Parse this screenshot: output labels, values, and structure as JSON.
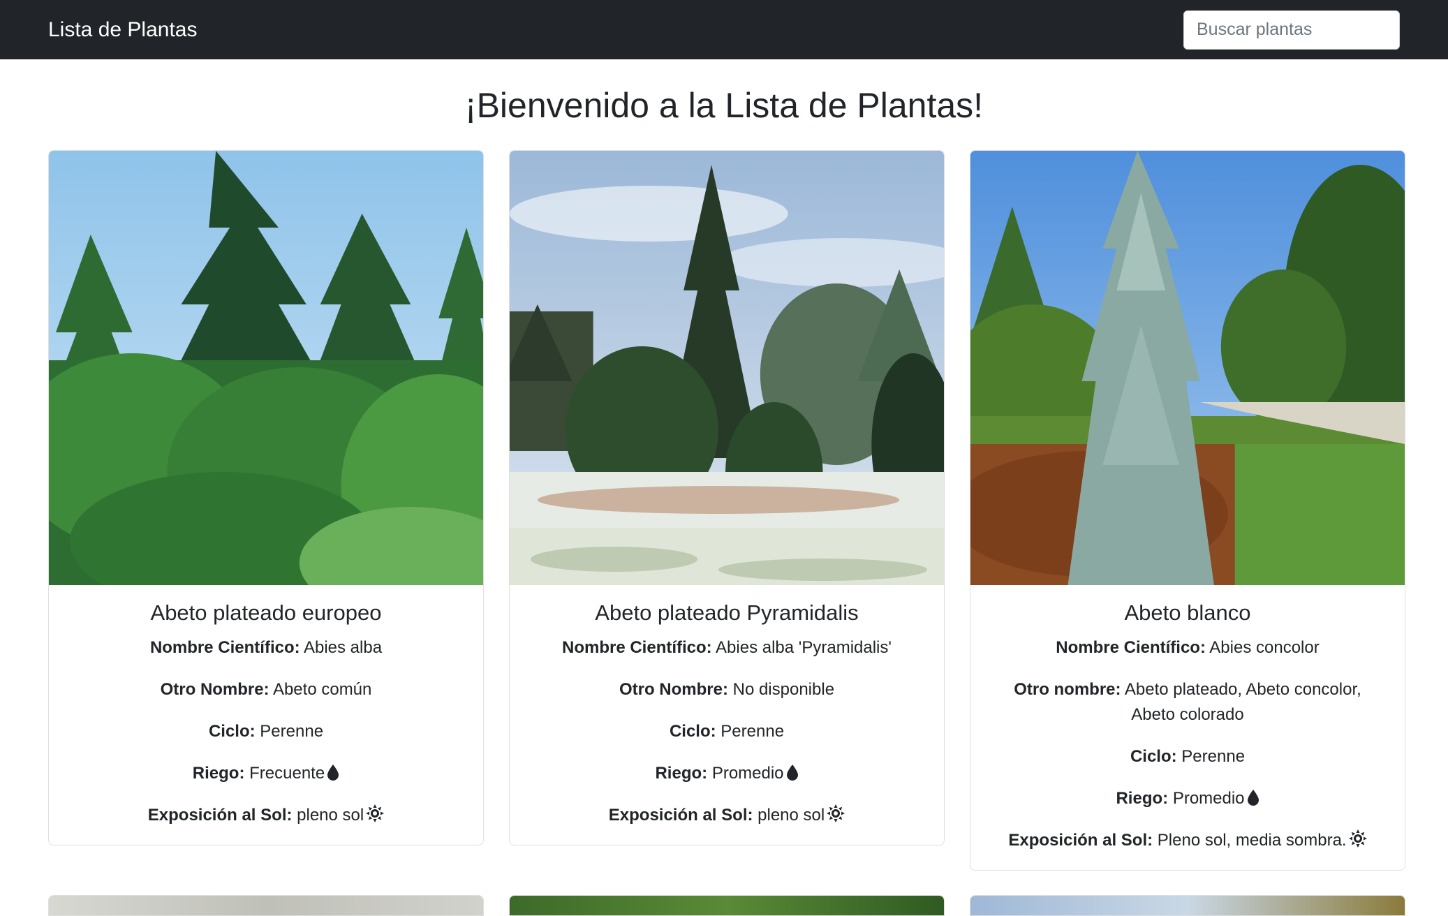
{
  "navbar": {
    "brand": "Lista de Plantas",
    "search_placeholder": "Buscar plantas"
  },
  "heading": "¡Bienvenido a la Lista de Plantas!",
  "plants": [
    {
      "title": "Abeto plateado europeo",
      "sci_label": "Nombre Científico:",
      "sci_value": "Abies alba",
      "other_label": "Otro Nombre:",
      "other_value": "Abeto común",
      "cycle_label": "Ciclo:",
      "cycle_value": "Perenne",
      "water_label": "Riego:",
      "water_value": "Frecuente",
      "sun_label": "Exposición al Sol:",
      "sun_value": "pleno sol"
    },
    {
      "title": "Abeto plateado Pyramidalis",
      "sci_label": "Nombre Científico:",
      "sci_value": "Abies alba 'Pyramidalis'",
      "other_label": "Otro Nombre:",
      "other_value": "No disponible",
      "cycle_label": "Ciclo:",
      "cycle_value": "Perenne",
      "water_label": "Riego:",
      "water_value": "Promedio",
      "sun_label": "Exposición al Sol:",
      "sun_value": "pleno sol"
    },
    {
      "title": "Abeto blanco",
      "sci_label": "Nombre Científico:",
      "sci_value": "Abies concolor",
      "other_label": "Otro nombre:",
      "other_value": "Abeto plateado, Abeto concolor, Abeto colorado",
      "cycle_label": "Ciclo:",
      "cycle_value": "Perenne",
      "water_label": "Riego:",
      "water_value": "Promedio",
      "sun_label": "Exposición al Sol:",
      "sun_value": "Pleno sol, media sombra."
    }
  ],
  "icons": {
    "water": "water-drop-icon",
    "sun": "sun-icon"
  },
  "colors": {
    "navbar": "#212529",
    "text": "#212529"
  }
}
